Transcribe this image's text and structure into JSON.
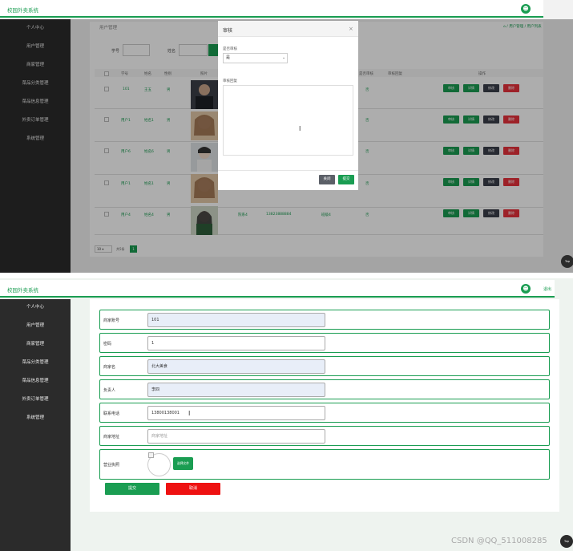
{
  "app": {
    "title": "校园外卖系统"
  },
  "nav": [
    {
      "label": "个人中心"
    },
    {
      "label": "用户管理"
    },
    {
      "label": "商家管理"
    },
    {
      "label": "菜品分类管理"
    },
    {
      "label": "菜品信息管理"
    },
    {
      "label": "外卖订单管理"
    },
    {
      "label": "系统管理"
    }
  ],
  "list_page": {
    "breadcrumb_left": "用户管理",
    "breadcrumb_right": "⌂ / 用户管理 / 用户列表",
    "search": {
      "field1_label": "学号",
      "field2_label": "姓名"
    },
    "columns": [
      "学号",
      "姓名",
      "性别",
      "照片",
      "是否审核",
      "审核回复",
      "操作"
    ],
    "rows": [
      {
        "id": "101",
        "name": "王五",
        "gender": "男",
        "phone": "",
        "audit": "否"
      },
      {
        "id": "用户1",
        "name": "姓名1",
        "gender": "男",
        "phone": "",
        "audit": "否"
      },
      {
        "id": "用户6",
        "name": "姓名6",
        "gender": "男",
        "phone": "",
        "audit": "否"
      },
      {
        "id": "用户1",
        "name": "姓名1",
        "gender": "男",
        "phone": "",
        "audit": "否"
      },
      {
        "id": "用户4",
        "name": "姓名4",
        "gender": "男",
        "extra1": "院系4",
        "phone": "13823888884",
        "extra2": "班级4",
        "audit": "否"
      }
    ],
    "row_buttons": [
      "审核",
      "详情",
      "修改",
      "删除"
    ],
    "pager": {
      "page_size": "10",
      "total": "共5条",
      "current": "1"
    },
    "top_label": "Top"
  },
  "modal": {
    "title": "审核",
    "close_glyph": "×",
    "field_audit_label": "是否审核",
    "field_audit_value": "是",
    "field_reply_label": "审核回复",
    "btn_cancel": "关闭",
    "btn_submit": "提交"
  },
  "form_page": {
    "topbar_right": "退出",
    "fields": [
      {
        "label": "商家账号",
        "value": "101",
        "placeholder": "",
        "filled": true
      },
      {
        "label": "密码",
        "value": "1",
        "placeholder": "",
        "filled": false
      },
      {
        "label": "商家名",
        "value": "北大美食",
        "placeholder": "",
        "filled": true
      },
      {
        "label": "负责人",
        "value": "李四",
        "placeholder": "",
        "filled": true
      },
      {
        "label": "联系电话",
        "value": "13800138001",
        "placeholder": "",
        "filled": false
      },
      {
        "label": "商家地址",
        "value": "",
        "placeholder": "商家地址",
        "filled": false
      }
    ],
    "license_label": "营业执照",
    "choose_file": "选择文件",
    "btn_submit": "提交",
    "btn_cancel": "取消",
    "top_label": "Top"
  },
  "watermark": "CSDN @QQ_511008285",
  "colors": {
    "brand": "#1a9d52",
    "danger": "#e8323c",
    "dark": "#3a3f4b",
    "sidebar": "#2b2b2b"
  },
  "icons": {
    "user": "user-icon",
    "close": "close-icon",
    "caret": "chevron-down-icon",
    "cursor": "text-cursor-icon"
  }
}
